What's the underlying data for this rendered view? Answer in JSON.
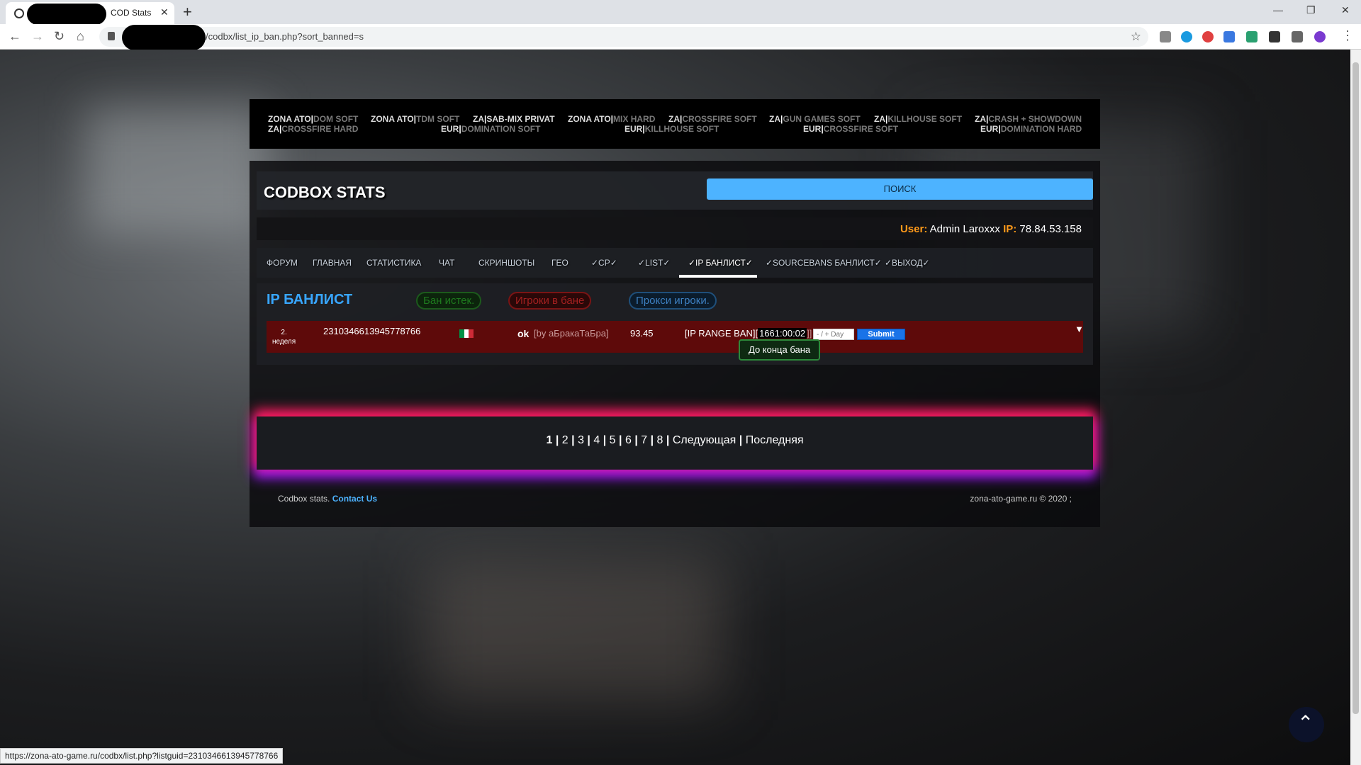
{
  "browser": {
    "tab_title": "COD Stats",
    "url": "/codbx/list_ip_ban.php?sort_banned=s",
    "status_url": "https://zona-ato-game.ru/codbx/list.php?listguid=2310346613945778766"
  },
  "servers": [
    {
      "a": "ZONA ATO",
      "b": "DOM SOFT"
    },
    {
      "a": "ZA",
      "b": "CROSSFIRE HARD"
    },
    {
      "a": "ZONA ATO",
      "b": "TDM SOFT"
    },
    {
      "a": "ZA",
      "b": "SAB-MIX PRIVAT"
    },
    {
      "a": "EUR",
      "b": "DOMINATION SOFT"
    },
    {
      "a": "ZONA ATO",
      "b": "MIX HARD"
    },
    {
      "a": "ZA",
      "b": "CROSSFIRE SOFT"
    },
    {
      "a": "EUR",
      "b": "KILLHOUSE SOFT"
    },
    {
      "a": "ZA",
      "b": "GUN GAMES SOFT"
    },
    {
      "a": "ZA",
      "b": "KILLHOUSE SOFT"
    },
    {
      "a": "EUR",
      "b": "CROSSFIRE SOFT"
    },
    {
      "a": "ZA",
      "b": "CRASH + SHOWDOWN"
    },
    {
      "a": "EUR",
      "b": "DOMINATION HARD"
    }
  ],
  "header": {
    "brand": "CODBOX STATS",
    "search_label": "ПОИСК"
  },
  "user": {
    "user_label": "User:",
    "user_name": "Admin Laroxxx",
    "ip_label": "IP:",
    "ip_value": "78.84.53.158"
  },
  "nav": [
    "ФОРУМ",
    "ГЛАВНАЯ",
    "СТАТИСТИКА",
    "ЧАТ",
    "СКРИНШОТЫ",
    "ГЕО",
    "✓CP✓",
    "✓LIST✓",
    "✓IP БАНЛИСТ✓",
    "✓SOURCEBANS БАНЛИСТ✓",
    "✓ВЫХОД✓"
  ],
  "content": {
    "title": "IP БАНЛИСТ",
    "filters": [
      "Бан истек.",
      "Игроки в бане",
      "Прокси игроки."
    ]
  },
  "ban": {
    "period_num": "2.",
    "period_unit": "неделя",
    "guid": "2310346613945778766",
    "nick": "ok",
    "by": "[by аБракаТаБра]",
    "score": "93.45",
    "reason_prefix": "[IP RANGE BAN][",
    "reason_time": "1661:00:02",
    "reason_suffix": "]]",
    "day_placeholder": "- / + Day",
    "submit": "Submit",
    "tooltip": "До конца бана",
    "flag_colors": [
      "#009246",
      "#ffffff",
      "#ce2b37"
    ]
  },
  "pager": {
    "current": "1",
    "pages": [
      "2",
      "3",
      "4",
      "5",
      "6",
      "7",
      "8"
    ],
    "next": "Следующая",
    "last": "Последняя"
  },
  "footer": {
    "left_text": "Codbox stats.",
    "contact": "Contact Us",
    "right_text": "zona-ato-game.ru © 2020 ;"
  }
}
